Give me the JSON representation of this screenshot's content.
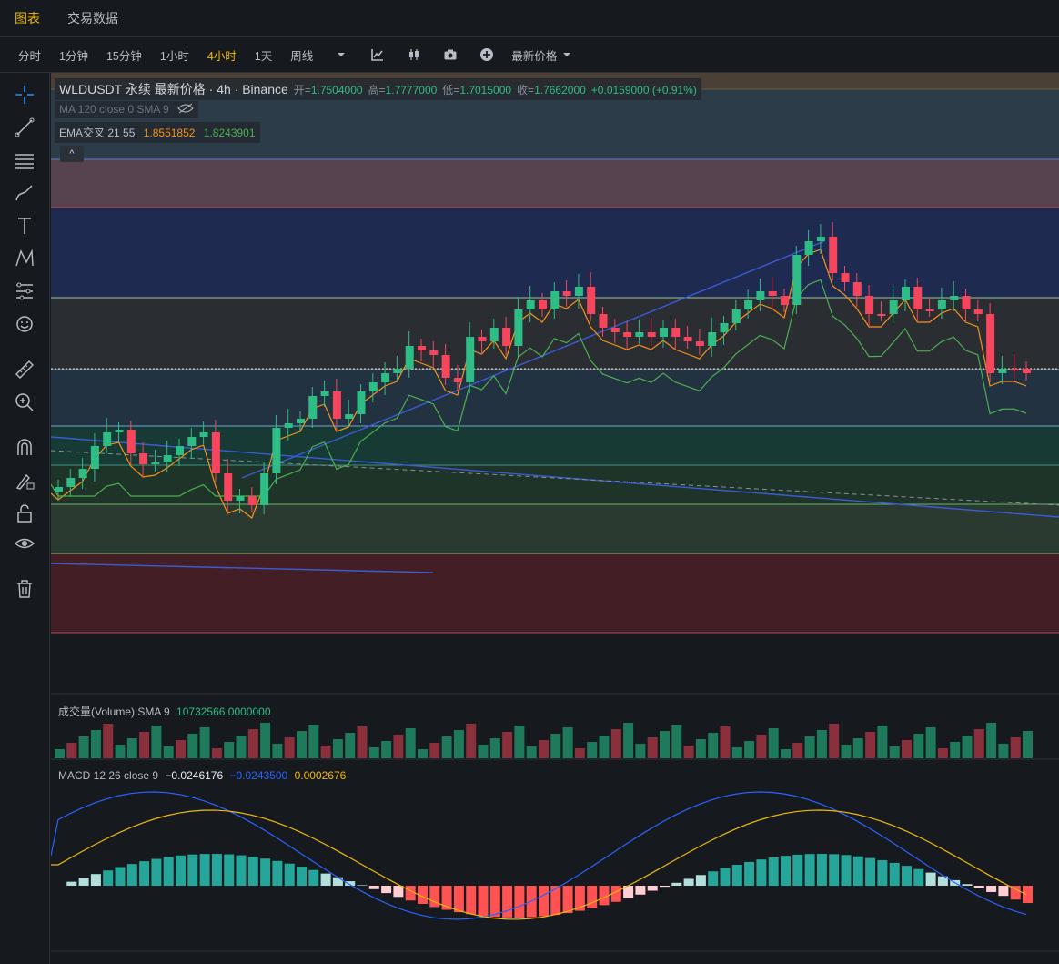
{
  "topbar": {
    "tabs": [
      {
        "label": "图表",
        "active": true
      },
      {
        "label": "交易数据",
        "active": false
      }
    ]
  },
  "intervals": [
    {
      "label": "分时"
    },
    {
      "label": "1分钟"
    },
    {
      "label": "15分钟"
    },
    {
      "label": "1小时"
    },
    {
      "label": "4小时",
      "active": true
    },
    {
      "label": "1天"
    },
    {
      "label": "周线"
    }
  ],
  "toolbar": {
    "price_type": "最新价格"
  },
  "legend": {
    "title": "WLDUSDT 永续 最新价格 · 4h · Binance",
    "open_label": "开=",
    "open": "1.7504000",
    "high_label": "高=",
    "high": "1.7777000",
    "low_label": "低=",
    "low": "1.7015000",
    "close_label": "收=",
    "close": "1.7662000",
    "change": "+0.0159000 (+0.91%)",
    "ma": "MA 120 close 0 SMA 9",
    "ema_label": "EMA交叉 21 55",
    "ema_fast": "1.8551852",
    "ema_slow": "1.8243901"
  },
  "volume_legend": {
    "label": "成交量(Volume) SMA 9",
    "value": "10732566.0000000"
  },
  "macd_legend": {
    "label": "MACD 12 26 close 9",
    "v1": "−0.0246176",
    "v2": "−0.0243500",
    "v3": "0.0002676"
  },
  "colors": {
    "up": "#2ebd85",
    "down": "#f6465d",
    "accent": "#f0b90b",
    "ema_fast": "#f7931a",
    "ema_slow": "#4caf50",
    "macd": "#2962ff",
    "signal": "#f0b90b"
  },
  "sidebar_icons": [
    "crosshair-icon",
    "trend-line-icon",
    "fib-lines-icon",
    "brush-icon",
    "text-icon",
    "pattern-icon",
    "measure-lines-icon",
    "emoji-icon",
    "ruler-icon",
    "zoom-in-icon",
    "magnet-icon",
    "lock-draw-icon",
    "unlock-icon",
    "eye-icon",
    "trash-icon"
  ]
}
